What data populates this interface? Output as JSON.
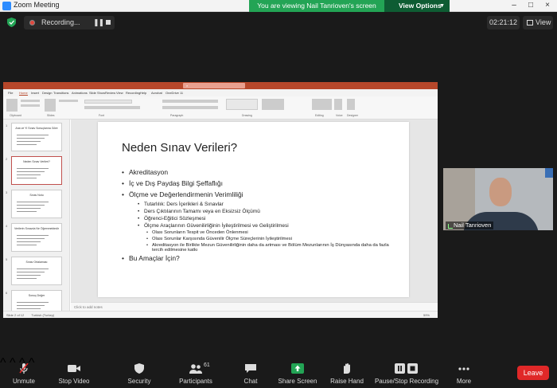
{
  "window": {
    "title": "Zoom Meeting"
  },
  "banner": {
    "text": "You are viewing Nail Tanrioven's screen",
    "view_options": "View Options"
  },
  "recording": {
    "label": "Recording..."
  },
  "timer": "02:21:12",
  "view_button": "View",
  "ppt": {
    "tabs": [
      "File",
      "Home",
      "Insert",
      "Design",
      "Transitions",
      "Animations",
      "Slide Show",
      "Review",
      "View",
      "Recording",
      "Help",
      "Acrobat",
      "OneDrive 11"
    ],
    "ribbon_groups": [
      "Clipboard",
      "Slides",
      "Font",
      "Paragraph",
      "Drawing",
      "Editing",
      "Voice",
      "Designer"
    ],
    "thumbnails": [
      {
        "num": "1",
        "title": "Ana ve Yl Sınav Sonuçlarına Göre"
      },
      {
        "num": "2",
        "title": "Neden Sınav Verileri?"
      },
      {
        "num": "3",
        "title": "Sınav Notu"
      },
      {
        "num": "4",
        "title": "Verilerin Sınavda Ne Öğrenmektedir"
      },
      {
        "num": "5",
        "title": "Sınav Ortalaması"
      },
      {
        "num": "6",
        "title": "Sonuç Değer"
      }
    ],
    "notes_placeholder": "Click to add notes",
    "status_left": "Slide 2 of 12",
    "status_lang": "Turkish (Turkey)",
    "status_zoom": "59%"
  },
  "slide": {
    "title": "Neden Sınav Verileri?",
    "bullets": [
      {
        "level": 1,
        "text": "Akreditasyon"
      },
      {
        "level": 1,
        "text": "İç ve Dış Paydaş Bilgi Şeffaflığı"
      },
      {
        "level": 1,
        "text": "Ölçme ve Değerlendirmenin Verimliliği"
      },
      {
        "level": 2,
        "text": "Tutarlılık: Ders İçerikleri & Sınavlar"
      },
      {
        "level": 2,
        "text": "Ders Çıktılarının Tamamı veya en Eksizsiz Ölçümü"
      },
      {
        "level": 2,
        "text": "Öğrenci-Eğitici Sözleşmesi"
      },
      {
        "level": 2,
        "text": "Ölçme Araçlarının Güvenilirliğinin İyileştirilmesi ve Geliştirilmesi"
      },
      {
        "level": 3,
        "text": "Olası Sorunların Tespit ve Önceden Önlenmesi"
      },
      {
        "level": 3,
        "text": "Olası Sorunlar Karşısında Güvenilir Ölçme Süreçlerinin İyileştirilmesi"
      },
      {
        "level": 3,
        "text": "Akreditasyon ile Birlikte Mezun Güvenilirliğinin daha da artması ve Bölüm Mezunlarının İş Dünyasında daha da fazla tercih edilmesine katkı"
      },
      {
        "level": 1,
        "text": "Bu Amaçlar İçin?"
      }
    ]
  },
  "participant": {
    "name": "Nail Tanrioven"
  },
  "toolbar": {
    "unmute": "Unmute",
    "stop_video": "Stop Video",
    "security": "Security",
    "participants": "Participants",
    "participants_count": "61",
    "chat": "Chat",
    "share_screen": "Share Screen",
    "raise_hand": "Raise Hand",
    "pause_stop_recording": "Pause/Stop Recording",
    "more": "More",
    "leave": "Leave"
  },
  "colors": {
    "share_green": "#23a455",
    "leave_red": "#e02828",
    "ppt_red": "#b7472a"
  }
}
